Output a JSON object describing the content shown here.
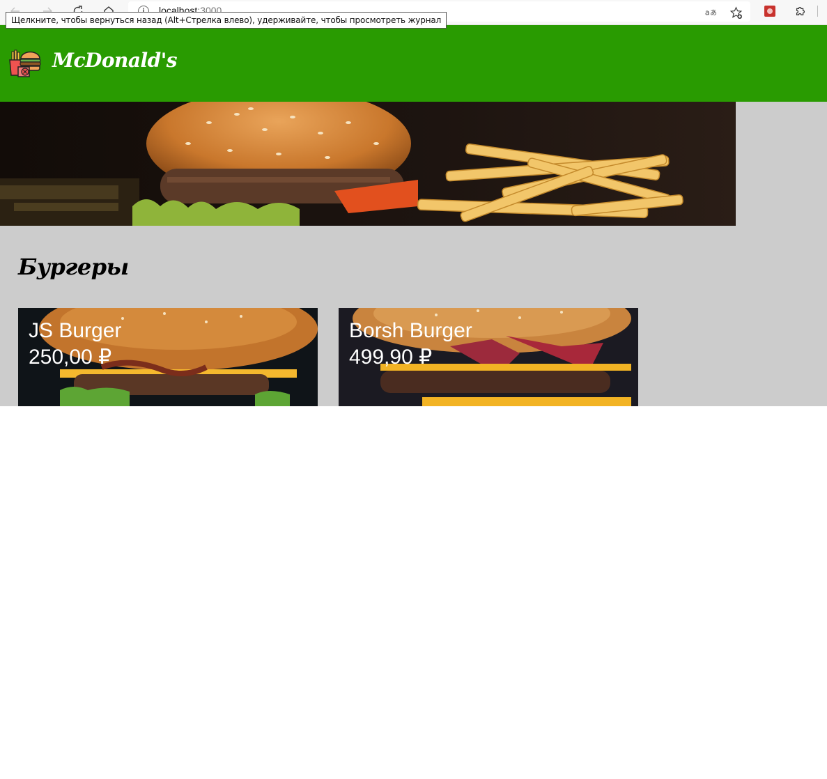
{
  "browser": {
    "url_host": "localhost",
    "url_port": ":3000",
    "tooltip": "Щелкните, чтобы вернуться назад (Alt+Стрелка влево), удерживайте, чтобы просмотреть журнал"
  },
  "header": {
    "brand": "McDonald's",
    "background_color": "#299b01"
  },
  "menu": {
    "section_title": "Бургеры",
    "items": [
      {
        "name": "JS Burger",
        "price": "250,00 ₽"
      },
      {
        "name": "Borsh Burger",
        "price": "499,90 ₽"
      }
    ]
  },
  "colors": {
    "page_background": "#cccccc",
    "header": "#299b01",
    "card_text": "#ffffff"
  },
  "icons": [
    "back-icon",
    "forward-icon",
    "refresh-icon",
    "home-icon",
    "site-info-icon",
    "read-aloud-icon",
    "favorite-add-icon",
    "extension-icon",
    "extensions-puzzle-icon",
    "fastfood-logo-icon"
  ]
}
